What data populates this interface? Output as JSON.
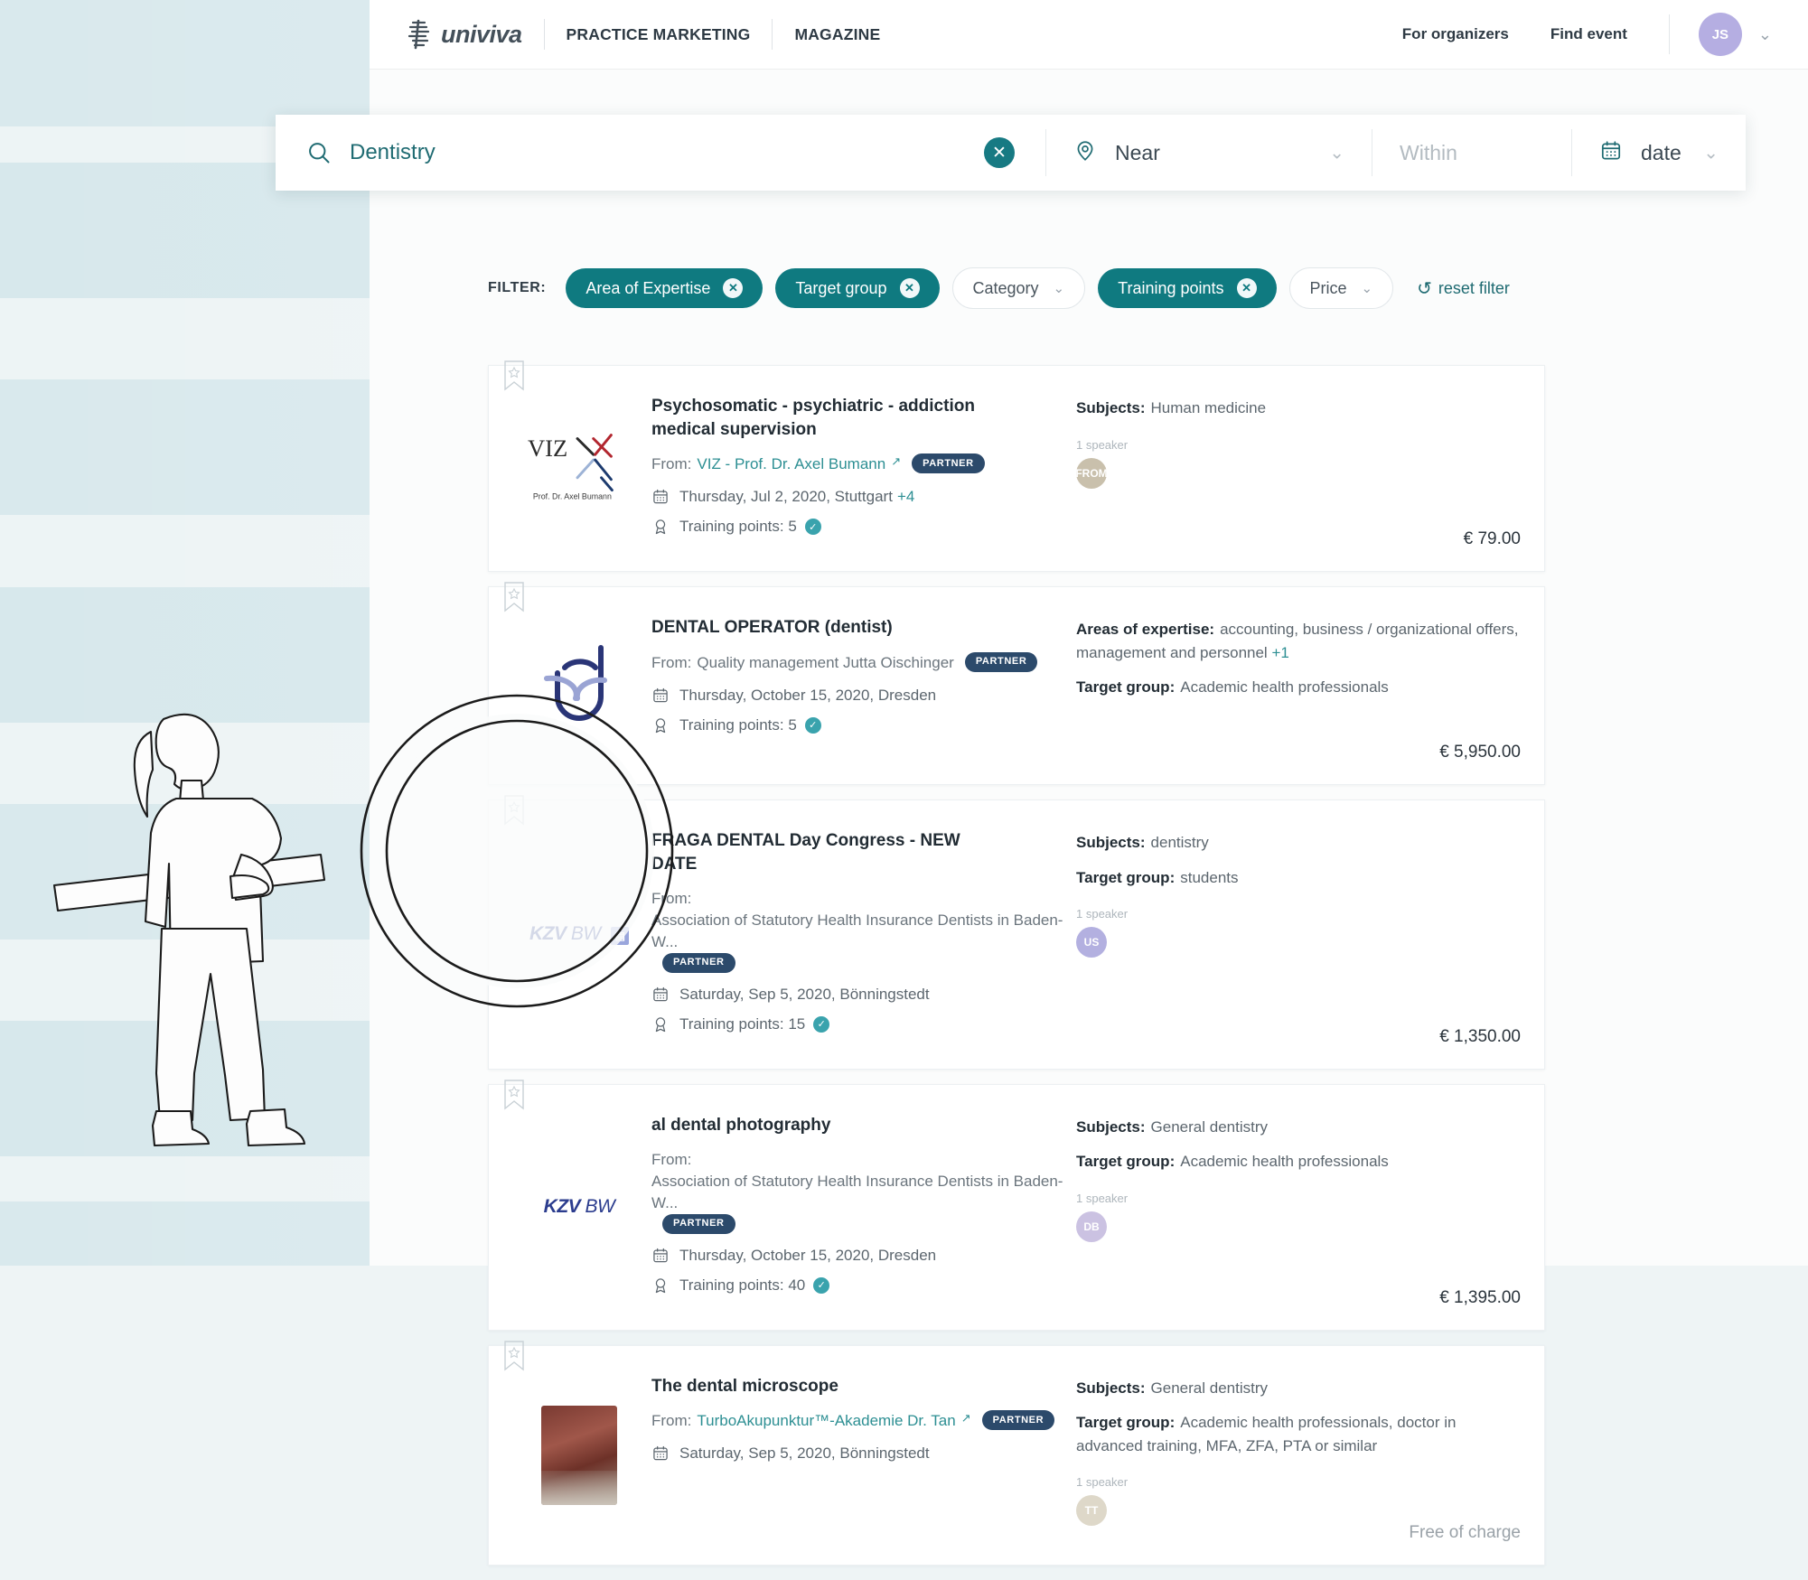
{
  "nav": {
    "brand": "univiva",
    "links": [
      "PRACTICE MARKETING",
      "MAGAZINE"
    ],
    "right_links": [
      "For organizers",
      "Find event"
    ],
    "avatar_initials": "JS",
    "chevron_icon": "chevron-down-icon"
  },
  "search": {
    "query_value": "Dentistry",
    "query_icon": "search-icon",
    "clear_icon": "close-icon",
    "near_value": "Near",
    "near_icon": "location-pin-icon",
    "within_placeholder": "Within",
    "date_value": "date",
    "date_icon": "calendar-icon",
    "caret_icon": "chevron-down-icon"
  },
  "filter": {
    "label": "FILTER:",
    "chips": [
      {
        "label": "Area of Expertise",
        "active": true
      },
      {
        "label": "Target group",
        "active": true
      },
      {
        "label": "Category",
        "active": false
      },
      {
        "label": "Training points",
        "active": true
      },
      {
        "label": "Price",
        "active": false
      }
    ],
    "reset_label": "reset filter",
    "reset_icon": "undo-icon",
    "accent_color": "#0f7a80"
  },
  "results": [
    {
      "title": "Psychosomatic - psychiatric - addiction medical supervision",
      "from_label": "From:",
      "organizer": "VIZ - Prof. Dr. Axel Bumann",
      "organizer_link": true,
      "partner_badge": "PARTNER",
      "date": "Thursday, Jul 2, 2020, Stuttgart",
      "date_plus": "+4",
      "points": "Training points: 5",
      "info": [
        {
          "label": "Subjects:",
          "value": "Human medicine"
        }
      ],
      "speaker_count": "1 speaker",
      "speaker_initials": "FROM",
      "speaker_color": "#c9c0ac",
      "price": "€ 79.00",
      "logo_type": "viz",
      "logo_text": "VIZ",
      "logo_sub": "Prof. Dr. Axel Bumann"
    },
    {
      "title": "DENTAL OPERATOR (dentist)",
      "from_label": "From:",
      "organizer": "Quality management Jutta Oischinger",
      "organizer_link": false,
      "partner_badge": "PARTNER",
      "date": "Thursday, October 15, 2020, Dresden",
      "date_plus": "",
      "points": "Training points: 5",
      "info": [
        {
          "label": "Areas of expertise:",
          "value": "accounting, business / organizational offers, management and personnel",
          "plus": "+1"
        },
        {
          "label": "Target group:",
          "value": "Academic health professionals"
        }
      ],
      "speaker_count": "",
      "speaker_initials": "",
      "speaker_color": "",
      "price": "€ 5,950.00",
      "logo_type": "dental-operator"
    },
    {
      "title": "FRAGA DENTAL Day Congress - NEW DATE",
      "from_label": "From:",
      "organizer": "Association of Statutory Health Insurance Dentists in Baden-W...",
      "organizer_link": false,
      "partner_badge": "PARTNER",
      "date": "Saturday, Sep 5, 2020, Bönningstedt",
      "date_plus": "",
      "points": "Training points: 15",
      "info": [
        {
          "label": "Subjects:",
          "value": "dentistry"
        },
        {
          "label": "Target group:",
          "value": "students"
        }
      ],
      "speaker_count": "1 speaker",
      "speaker_initials": "US",
      "speaker_color": "#b3b0e0",
      "price": "€ 1,350.00",
      "logo_type": "kzv",
      "logo_text": "KZV",
      "logo_sub": "BW"
    },
    {
      "title": "al dental photography",
      "from_label": "From:",
      "organizer": "Association of Statutory Health Insurance Dentists in Baden-W...",
      "organizer_link": false,
      "partner_badge": "PARTNER",
      "date": "Thursday, October 15, 2020, Dresden",
      "date_plus": "",
      "points": "Training points: 40",
      "info": [
        {
          "label": "Subjects:",
          "value": "General dentistry"
        },
        {
          "label": "Target group:",
          "value": "Academic health professionals"
        }
      ],
      "speaker_count": "1 speaker",
      "speaker_initials": "DB",
      "speaker_color": "#cbc2e2",
      "price": "€ 1,395.00",
      "logo_type": "kzv",
      "logo_text": "KZV",
      "logo_sub": "BW"
    },
    {
      "title": "The dental microscope",
      "from_label": "From:",
      "organizer": "TurboAkupunktur™-Akademie Dr. Tan",
      "organizer_link": true,
      "partner_badge": "PARTNER",
      "date": "Saturday, Sep 5, 2020, Bönningstedt",
      "date_plus": "",
      "points": "",
      "info": [
        {
          "label": "Subjects:",
          "value": "General dentistry"
        },
        {
          "label": "Target group:",
          "value": "Academic health professionals, doctor in advanced training, MFA, ZFA, PTA or similar"
        }
      ],
      "speaker_count": "1 speaker",
      "speaker_initials": "TT",
      "speaker_color": "#ded8c9",
      "price": "Free of charge",
      "logo_type": "photo"
    }
  ],
  "icons": {
    "bookmark": "bookmark-icon",
    "calendar": "calendar-icon",
    "award": "award-ribbon-icon",
    "verified": "verified-check-icon",
    "external": "external-link-icon"
  },
  "illustration": {
    "figure": "person-with-magnifier-illustration",
    "magnifier": "magnifying-glass-overlay"
  }
}
